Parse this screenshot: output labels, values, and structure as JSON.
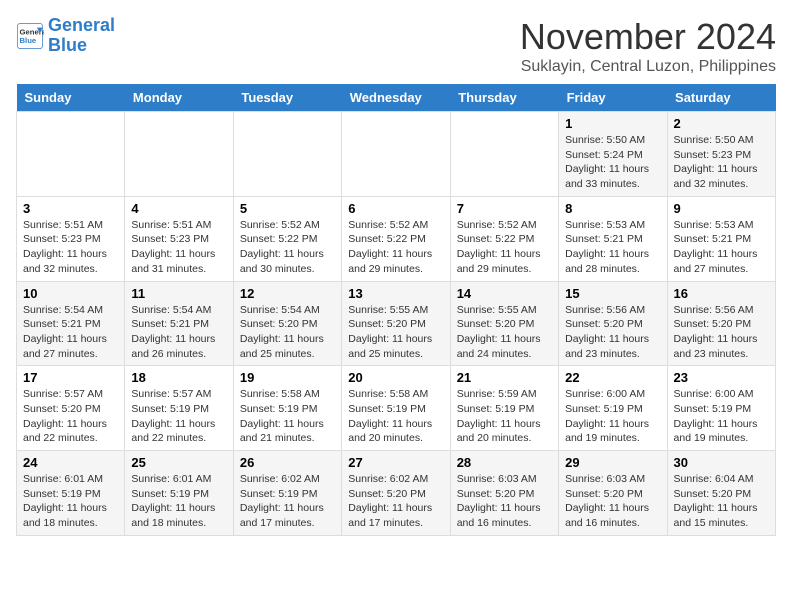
{
  "logo": {
    "line1": "General",
    "line2": "Blue"
  },
  "title": "November 2024",
  "location": "Suklayin, Central Luzon, Philippines",
  "days_of_week": [
    "Sunday",
    "Monday",
    "Tuesday",
    "Wednesday",
    "Thursday",
    "Friday",
    "Saturday"
  ],
  "weeks": [
    [
      {
        "day": "",
        "info": ""
      },
      {
        "day": "",
        "info": ""
      },
      {
        "day": "",
        "info": ""
      },
      {
        "day": "",
        "info": ""
      },
      {
        "day": "",
        "info": ""
      },
      {
        "day": "1",
        "info": "Sunrise: 5:50 AM\nSunset: 5:24 PM\nDaylight: 11 hours\nand 33 minutes."
      },
      {
        "day": "2",
        "info": "Sunrise: 5:50 AM\nSunset: 5:23 PM\nDaylight: 11 hours\nand 32 minutes."
      }
    ],
    [
      {
        "day": "3",
        "info": "Sunrise: 5:51 AM\nSunset: 5:23 PM\nDaylight: 11 hours\nand 32 minutes."
      },
      {
        "day": "4",
        "info": "Sunrise: 5:51 AM\nSunset: 5:23 PM\nDaylight: 11 hours\nand 31 minutes."
      },
      {
        "day": "5",
        "info": "Sunrise: 5:52 AM\nSunset: 5:22 PM\nDaylight: 11 hours\nand 30 minutes."
      },
      {
        "day": "6",
        "info": "Sunrise: 5:52 AM\nSunset: 5:22 PM\nDaylight: 11 hours\nand 29 minutes."
      },
      {
        "day": "7",
        "info": "Sunrise: 5:52 AM\nSunset: 5:22 PM\nDaylight: 11 hours\nand 29 minutes."
      },
      {
        "day": "8",
        "info": "Sunrise: 5:53 AM\nSunset: 5:21 PM\nDaylight: 11 hours\nand 28 minutes."
      },
      {
        "day": "9",
        "info": "Sunrise: 5:53 AM\nSunset: 5:21 PM\nDaylight: 11 hours\nand 27 minutes."
      }
    ],
    [
      {
        "day": "10",
        "info": "Sunrise: 5:54 AM\nSunset: 5:21 PM\nDaylight: 11 hours\nand 27 minutes."
      },
      {
        "day": "11",
        "info": "Sunrise: 5:54 AM\nSunset: 5:21 PM\nDaylight: 11 hours\nand 26 minutes."
      },
      {
        "day": "12",
        "info": "Sunrise: 5:54 AM\nSunset: 5:20 PM\nDaylight: 11 hours\nand 25 minutes."
      },
      {
        "day": "13",
        "info": "Sunrise: 5:55 AM\nSunset: 5:20 PM\nDaylight: 11 hours\nand 25 minutes."
      },
      {
        "day": "14",
        "info": "Sunrise: 5:55 AM\nSunset: 5:20 PM\nDaylight: 11 hours\nand 24 minutes."
      },
      {
        "day": "15",
        "info": "Sunrise: 5:56 AM\nSunset: 5:20 PM\nDaylight: 11 hours\nand 23 minutes."
      },
      {
        "day": "16",
        "info": "Sunrise: 5:56 AM\nSunset: 5:20 PM\nDaylight: 11 hours\nand 23 minutes."
      }
    ],
    [
      {
        "day": "17",
        "info": "Sunrise: 5:57 AM\nSunset: 5:20 PM\nDaylight: 11 hours\nand 22 minutes."
      },
      {
        "day": "18",
        "info": "Sunrise: 5:57 AM\nSunset: 5:19 PM\nDaylight: 11 hours\nand 22 minutes."
      },
      {
        "day": "19",
        "info": "Sunrise: 5:58 AM\nSunset: 5:19 PM\nDaylight: 11 hours\nand 21 minutes."
      },
      {
        "day": "20",
        "info": "Sunrise: 5:58 AM\nSunset: 5:19 PM\nDaylight: 11 hours\nand 20 minutes."
      },
      {
        "day": "21",
        "info": "Sunrise: 5:59 AM\nSunset: 5:19 PM\nDaylight: 11 hours\nand 20 minutes."
      },
      {
        "day": "22",
        "info": "Sunrise: 6:00 AM\nSunset: 5:19 PM\nDaylight: 11 hours\nand 19 minutes."
      },
      {
        "day": "23",
        "info": "Sunrise: 6:00 AM\nSunset: 5:19 PM\nDaylight: 11 hours\nand 19 minutes."
      }
    ],
    [
      {
        "day": "24",
        "info": "Sunrise: 6:01 AM\nSunset: 5:19 PM\nDaylight: 11 hours\nand 18 minutes."
      },
      {
        "day": "25",
        "info": "Sunrise: 6:01 AM\nSunset: 5:19 PM\nDaylight: 11 hours\nand 18 minutes."
      },
      {
        "day": "26",
        "info": "Sunrise: 6:02 AM\nSunset: 5:19 PM\nDaylight: 11 hours\nand 17 minutes."
      },
      {
        "day": "27",
        "info": "Sunrise: 6:02 AM\nSunset: 5:20 PM\nDaylight: 11 hours\nand 17 minutes."
      },
      {
        "day": "28",
        "info": "Sunrise: 6:03 AM\nSunset: 5:20 PM\nDaylight: 11 hours\nand 16 minutes."
      },
      {
        "day": "29",
        "info": "Sunrise: 6:03 AM\nSunset: 5:20 PM\nDaylight: 11 hours\nand 16 minutes."
      },
      {
        "day": "30",
        "info": "Sunrise: 6:04 AM\nSunset: 5:20 PM\nDaylight: 11 hours\nand 15 minutes."
      }
    ]
  ]
}
